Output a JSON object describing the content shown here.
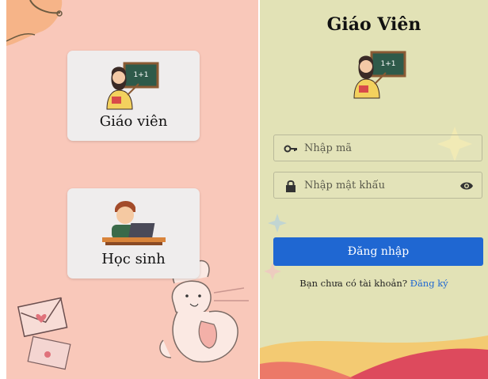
{
  "role_select": {
    "teacher_label": "Giáo viên",
    "student_label": "Học sinh"
  },
  "login": {
    "title": "Giáo Viên",
    "code_placeholder": "Nhập mã",
    "password_placeholder": "Nhập mật khẩu",
    "login_button": "Đăng nhập",
    "no_account_text": "Bạn chưa có tài khoản?",
    "register_link": "Đăng ký",
    "board_text": "1+1"
  },
  "icons": [
    "key-icon",
    "lock-icon",
    "eye-icon",
    "teacher-icon",
    "student-icon"
  ],
  "colors": {
    "left_bg": "#f9c8ba",
    "right_bg": "#e2e2b6",
    "accent": "#1f67d2"
  }
}
